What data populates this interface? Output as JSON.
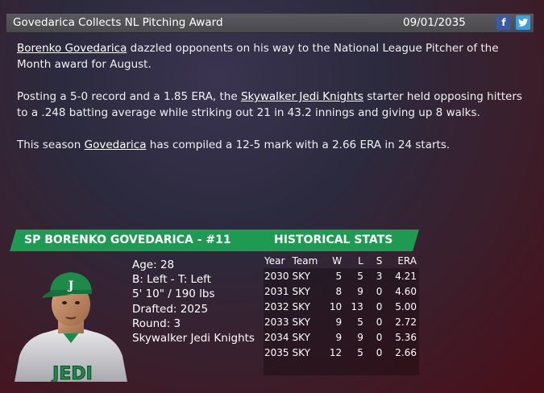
{
  "header": {
    "title": "Govedarica Collects NL Pitching Award",
    "date": "09/01/2035",
    "facebook_glyph": "f",
    "twitter_glyph": "t"
  },
  "article": {
    "p1": {
      "link": "Borenko Govedarica",
      "text": " dazzled opponents on his way to the National League Pitcher of the Month award for August."
    },
    "p2": {
      "pre": "Posting a 5-0 record and a 1.85 ERA, the ",
      "link": "Skywalker Jedi Knights",
      "post": " starter held opposing hitters to a .248 batting average while striking out 21 in 43.2 innings and giving up 8 walks."
    },
    "p3": {
      "pre": "This season ",
      "link": "Govedarica",
      "post": " has compiled a 12-5 mark with a 2.66 ERA in 24 starts."
    }
  },
  "player": {
    "bar_title": "SP BORENKO GOVEDARICA - #11",
    "age": "Age: 28",
    "bats_throws": "B: Left - T: Left",
    "height_weight": "5' 10\" / 190 lbs",
    "drafted": "Drafted: 2025",
    "round": "Round: 3",
    "team": "Skywalker Jedi Knights",
    "jersey_text": "JEDI"
  },
  "stats": {
    "title": "HISTORICAL STATS",
    "headers": [
      "Year",
      "Team",
      "W",
      "L",
      "S",
      "ERA"
    ],
    "rows": [
      [
        "2030",
        "SKY",
        "5",
        "5",
        "3",
        "4.21"
      ],
      [
        "2031",
        "SKY",
        "8",
        "9",
        "0",
        "4.60"
      ],
      [
        "2032",
        "SKY",
        "10",
        "13",
        "0",
        "5.00"
      ],
      [
        "2033",
        "SKY",
        "9",
        "5",
        "0",
        "2.72"
      ],
      [
        "2034",
        "SKY",
        "9",
        "9",
        "0",
        "5.36"
      ],
      [
        "2035",
        "SKY",
        "12",
        "5",
        "0",
        "2.66"
      ]
    ]
  },
  "colors": {
    "accent_green": "#1f9a52",
    "facebook": "#3b5aa0",
    "twitter": "#3aa0e0"
  }
}
